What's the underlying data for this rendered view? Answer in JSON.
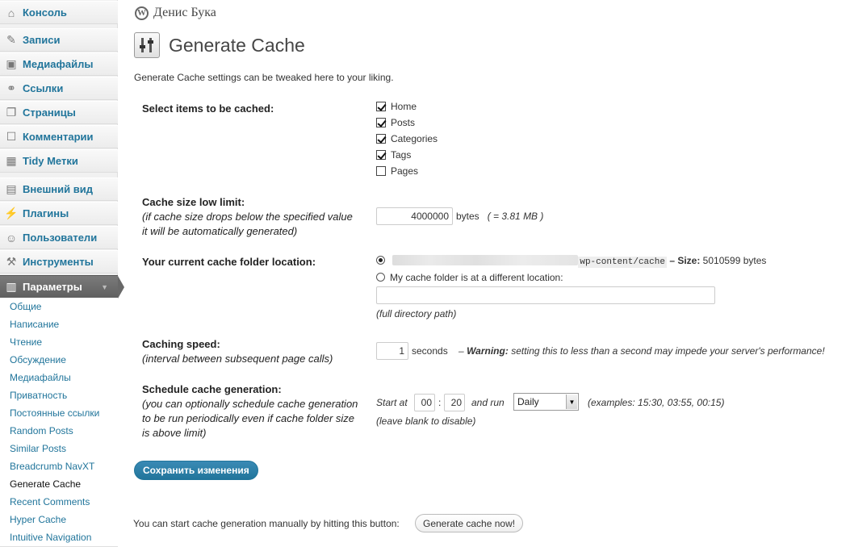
{
  "sidebar": {
    "menu": [
      {
        "label": "Консоль",
        "icon": "dashboard-icon",
        "glyph": "⌂"
      },
      {
        "label": "Записи",
        "icon": "posts-icon",
        "glyph": "✎"
      },
      {
        "label": "Медиафайлы",
        "icon": "media-icon",
        "glyph": "▣"
      },
      {
        "label": "Ссылки",
        "icon": "links-icon",
        "glyph": "⚭"
      },
      {
        "label": "Страницы",
        "icon": "pages-icon",
        "glyph": "❐"
      },
      {
        "label": "Комментарии",
        "icon": "comments-icon",
        "glyph": "☐"
      },
      {
        "label": "Tidy Метки",
        "icon": "tags-icon",
        "glyph": "▦"
      },
      {
        "label": "Внешний вид",
        "icon": "appearance-icon",
        "glyph": "▤"
      },
      {
        "label": "Плагины",
        "icon": "plugins-icon",
        "glyph": "⚡"
      },
      {
        "label": "Пользователи",
        "icon": "users-icon",
        "glyph": "☺"
      },
      {
        "label": "Инструменты",
        "icon": "tools-icon",
        "glyph": "⚒"
      },
      {
        "label": "Параметры",
        "icon": "settings-icon",
        "glyph": "▥"
      }
    ],
    "submenu": [
      "Общие",
      "Написание",
      "Чтение",
      "Обсуждение",
      "Медиафайлы",
      "Приватность",
      "Постоянные ссылки",
      "Random Posts",
      "Similar Posts",
      "Breadcrumb NavXT",
      "Generate Cache",
      "Recent Comments",
      "Hyper Cache",
      "Intuitive Navigation"
    ]
  },
  "header": {
    "site_name": "Денис Бука",
    "logo_letter": "W"
  },
  "page": {
    "title": "Generate Cache",
    "intro": "Generate Cache settings can be tweaked here to your liking."
  },
  "items": {
    "label": "Select items to be cached:",
    "options": [
      {
        "label": "Home",
        "checked": true
      },
      {
        "label": "Posts",
        "checked": true
      },
      {
        "label": "Categories",
        "checked": true
      },
      {
        "label": "Tags",
        "checked": true
      },
      {
        "label": "Pages",
        "checked": false
      }
    ]
  },
  "size_limit": {
    "label": "Cache size low limit:",
    "hint1": "(if cache size drops below the specified value",
    "hint2": "it will be automatically generated)",
    "value": "4000000",
    "unit": "bytes",
    "converted": "( = 3.81 MB )"
  },
  "folder": {
    "label": "Your current cache folder location:",
    "path_tail": "wp-content/cache",
    "size_label": "– Size:",
    "size_value": "5010599 bytes",
    "other_label": "My cache folder is at a different location:",
    "other_value": "",
    "other_hint": "(full directory path)"
  },
  "speed": {
    "label": "Caching speed:",
    "hint": "(interval between subsequent page calls)",
    "value": "1",
    "unit": "seconds",
    "warning_bold": "Warning:",
    "warning_text": "setting this to less than a second may impede your server's performance!"
  },
  "schedule": {
    "label": "Schedule cache generation:",
    "hint1": "(you can optionally schedule cache generation",
    "hint2": "to be run periodically even if cache folder size",
    "hint3": "is above limit)",
    "start_label": "Start at",
    "hour": "00",
    "minute": "20",
    "run_label": "and run",
    "frequency": "Daily",
    "examples": "(examples: 15:30, 03:55, 00:15)",
    "blank_hint": "(leave blank to disable)"
  },
  "buttons": {
    "save": "Сохранить изменения",
    "manual_text": "You can start cache generation manually by hitting this button:",
    "generate": "Generate cache now!"
  },
  "colors": {
    "link": "#21759b",
    "primary_button": "#21759b",
    "current_menu": "#636363"
  }
}
